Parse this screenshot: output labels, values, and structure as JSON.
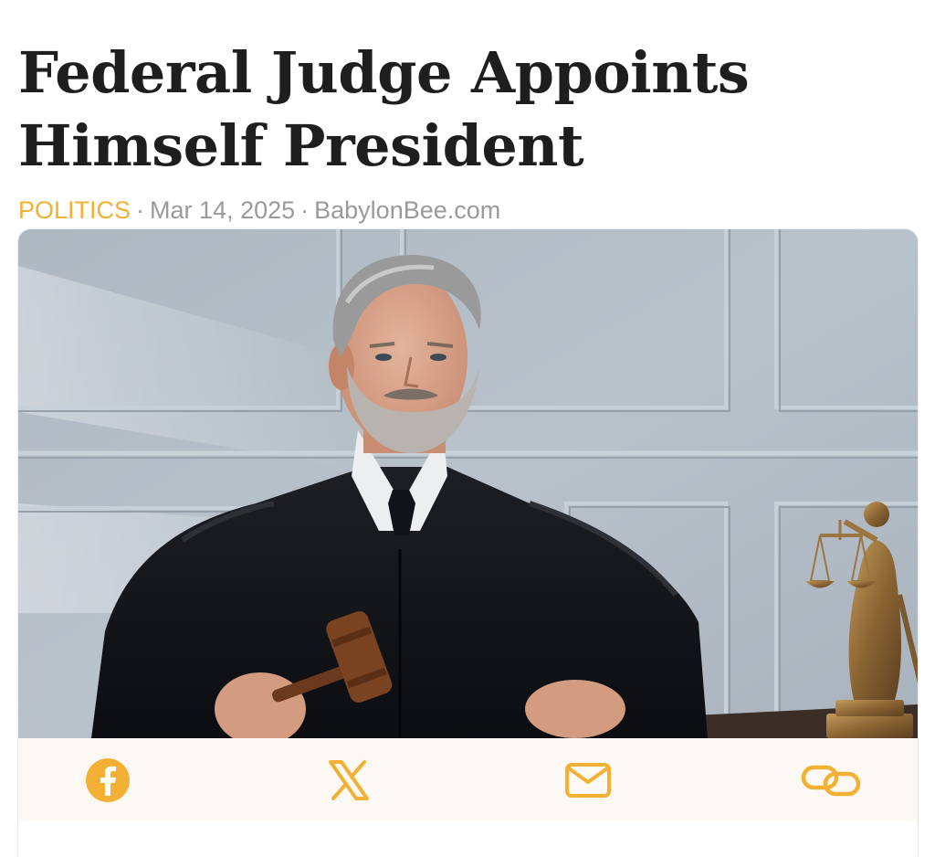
{
  "article": {
    "headline_line1": "Federal Judge Appoints",
    "headline_line2": "Himself President",
    "category": "POLITICS",
    "date": "Mar 14, 2025",
    "source": "BabylonBee.com",
    "separator": "·"
  },
  "share": {
    "icons": [
      "facebook-icon",
      "x-icon",
      "email-icon",
      "link-icon"
    ]
  },
  "colors": {
    "accent": "#f2b134",
    "headline": "#1e1e1e",
    "meta": "#9a9a9a",
    "share_bar_bg": "#fcf9f4"
  }
}
